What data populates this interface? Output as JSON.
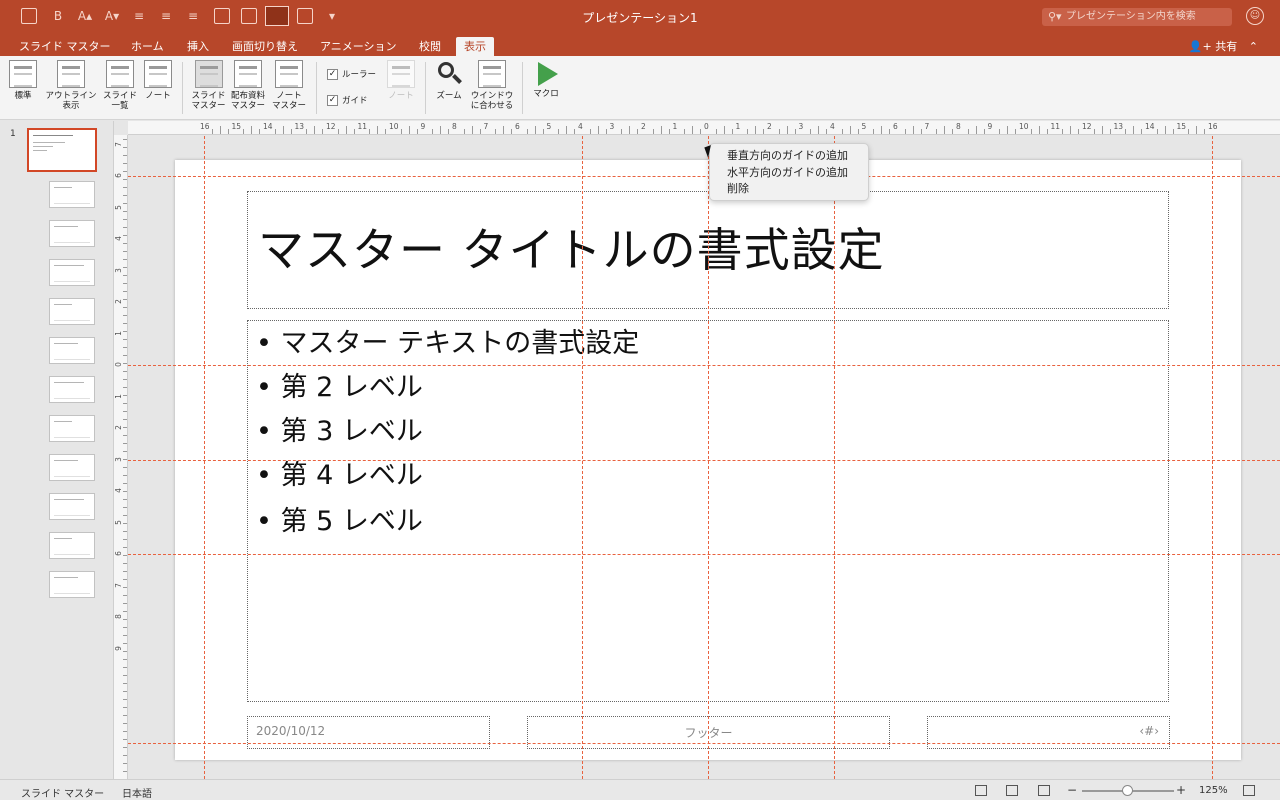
{
  "window": {
    "title": "プレゼンテーション1"
  },
  "search": {
    "placeholder": "プレゼンテーション内を検索"
  },
  "tabs": [
    {
      "label": "スライド マスター"
    },
    {
      "label": "ホーム"
    },
    {
      "label": "挿入"
    },
    {
      "label": "画面切り替え"
    },
    {
      "label": "アニメーション"
    },
    {
      "label": "校閲"
    },
    {
      "label": "表示",
      "active": true
    }
  ],
  "share": {
    "label": "共有"
  },
  "ribbon": {
    "normal": "標準",
    "outline": "アウトライン\n表示",
    "sorter": "スライド\n一覧",
    "notes": "ノート",
    "slide_master": "スライド\nマスター",
    "handout_master": "配布資料\nマスター",
    "notes_master": "ノート\nマスター",
    "ruler": "ルーラー",
    "guides": "ガイド",
    "notes_disabled": "ノート",
    "zoom": "ズーム",
    "fit_window": "ウインドウ\nに合わせる",
    "macro": "マクロ"
  },
  "thumbnails": {
    "first_number": "1",
    "count": 12
  },
  "slide": {
    "title": "マスター タイトルの書式設定",
    "bullets": [
      "• マスター テキストの書式設定",
      "• 第 2 レベル",
      "• 第 3 レベル",
      "• 第 4 レベル",
      "• 第 5 レベル"
    ],
    "date": "2020/10/12",
    "footer": "フッター",
    "page_number": "‹#›"
  },
  "ruler": {
    "horizontal_labels": [
      "16",
      "15",
      "14",
      "13",
      "12",
      "11",
      "10",
      "9",
      "8",
      "7",
      "6",
      "5",
      "4",
      "3",
      "2",
      "1",
      "0",
      "1",
      "2",
      "3",
      "4",
      "5",
      "6",
      "7",
      "8",
      "9",
      "10",
      "11",
      "12",
      "13",
      "14",
      "15",
      "16"
    ],
    "vertical_labels": [
      "9",
      "8",
      "7",
      "6",
      "5",
      "4",
      "3",
      "2",
      "1",
      "0",
      "1",
      "2",
      "3",
      "4",
      "5",
      "6",
      "7",
      "8",
      "9"
    ]
  },
  "context_menu": {
    "items": [
      "垂直方向のガイドの追加",
      "水平方向のガイドの追加",
      "削除"
    ]
  },
  "status": {
    "view": "スライド マスター",
    "language": "日本語",
    "zoom": "125%",
    "zoom_minus": "−",
    "zoom_plus": "+"
  },
  "colors": {
    "accent": "#b7472a",
    "guide": "#e8623f",
    "selection": "#d24726"
  }
}
